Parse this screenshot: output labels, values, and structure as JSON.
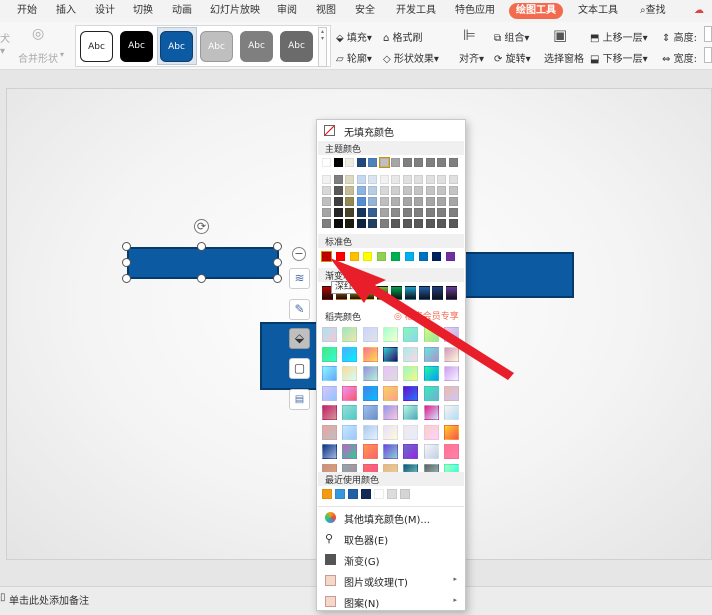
{
  "menu": {
    "tabs": [
      {
        "label": "开始"
      },
      {
        "label": "插入"
      },
      {
        "label": "设计"
      },
      {
        "label": "切换"
      },
      {
        "label": "动画"
      },
      {
        "label": "幻灯片放映"
      },
      {
        "label": "审阅"
      },
      {
        "label": "视图"
      },
      {
        "label": "安全"
      },
      {
        "label": "开发工具"
      },
      {
        "label": "特色应用"
      },
      {
        "label": "绘图工具"
      },
      {
        "label": "文本工具"
      }
    ],
    "search_label": "查找"
  },
  "ribbon": {
    "merge_shape": "合并形状",
    "style_sample": "Abc",
    "fill": "填充",
    "format_painter": "格式刷",
    "outline": "轮廓",
    "shape_effects": "形状效果",
    "align": "对齐",
    "group": "组合",
    "rotate": "旋转",
    "selection_pane": "选择窗格",
    "bring_forward": "上移一层",
    "send_backward": "下移一层",
    "height_label": "高度:",
    "width_label": "宽度:"
  },
  "dropdown": {
    "no_fill": "无填充颜色",
    "theme_colors": "主题颜色",
    "standard_colors": "标准色",
    "gradient_label": "渐变填充",
    "tooltip": "深红",
    "daoke_colors": "稻壳颜色",
    "member_badge": "稻壳会员专享",
    "recent_colors": "最近使用颜色",
    "items": [
      {
        "label": "其他填充颜色(M)...",
        "has_submenu": false
      },
      {
        "label": "取色器(E)",
        "has_submenu": false
      },
      {
        "label": "渐变(G)",
        "has_submenu": false
      },
      {
        "label": "图片或纹理(T)",
        "has_submenu": true
      },
      {
        "label": "图案(N)",
        "has_submenu": true
      }
    ],
    "theme_top_row": [
      "#ffffff",
      "#000000",
      "#eeece1",
      "#1f497d",
      "#4f81bd",
      "#c0c0c0",
      "#a6a6a6",
      "#808080",
      "#808080",
      "#808080",
      "#808080",
      "#808080"
    ],
    "theme_shades": [
      [
        "#f2f2f2",
        "#7f7f7f",
        "#ddd9c3",
        "#c6d9f0",
        "#dbe5f1",
        "#f2f2f2",
        "#e8e8e8",
        "#e0e0e0",
        "#e0e0e0",
        "#e0e0e0",
        "#e0e0e0",
        "#e0e0e0"
      ],
      [
        "#d8d8d8",
        "#595959",
        "#c4bd97",
        "#8db3e2",
        "#b8cce4",
        "#d8d8d8",
        "#cfcfcf",
        "#c4c4c4",
        "#c4c4c4",
        "#c4c4c4",
        "#c4c4c4",
        "#c4c4c4"
      ],
      [
        "#bfbfbf",
        "#3f3f3f",
        "#938953",
        "#548dd4",
        "#95b3d7",
        "#bfbfbf",
        "#b0b0b0",
        "#a6a6a6",
        "#a6a6a6",
        "#a6a6a6",
        "#a6a6a6",
        "#a6a6a6"
      ],
      [
        "#a5a5a5",
        "#262626",
        "#494429",
        "#17365d",
        "#366092",
        "#a5a5a5",
        "#8c8c8c",
        "#7f7f7f",
        "#7f7f7f",
        "#7f7f7f",
        "#7f7f7f",
        "#7f7f7f"
      ],
      [
        "#7f7f7f",
        "#0c0c0c",
        "#1d1b10",
        "#0f243e",
        "#244061",
        "#7f7f7f",
        "#595959",
        "#595959",
        "#595959",
        "#595959",
        "#595959",
        "#595959"
      ]
    ],
    "standard": [
      "#c00000",
      "#ff0000",
      "#ffc000",
      "#ffff00",
      "#92d050",
      "#00b050",
      "#00b0f0",
      "#0070c0",
      "#002060",
      "#7030a0"
    ],
    "gradient_row": [
      "#c00000",
      "#e36c09",
      "#f5b800",
      "#f0e000",
      "#7dbb3a",
      "#00a050",
      "#1b9fd0",
      "#1f60b0",
      "#1c3d80",
      "#6a3aa0"
    ],
    "recent": [
      "#f39c12",
      "#3498db",
      "#1f5fa8",
      "#132a55",
      "#ffffff",
      "#dddddd",
      "#d5d5d5"
    ],
    "gradients": [
      [
        "#a8e6f0,#f7c6d9",
        "#9be7c4,#f2e6a8",
        "#c9d6ff,#e2e2e2",
        "#a1ffce,#faffd1",
        "#84fab0,#8fd3f4",
        "#d4fc79,#96e6a1",
        "#fbc2eb,#a6c1ee"
      ],
      [
        "#43e97b,#38f9d7",
        "#4facfe,#00f2fe",
        "#fa709a,#fee140",
        "#30cfd0,#330867",
        "#a8edea,#fed6e3",
        "#5ee7df,#b490ca",
        "#d299c2,#fef9d7"
      ],
      [
        "#89f7fe,#66a6ff",
        "#fddb92,#d1fdff",
        "#9890e3,#b1f4cf",
        "#ebc0fd,#d9ded8",
        "#96fbc4,#f9f586",
        "#2af598,#009efd",
        "#cd9cf2,#f6f3ff"
      ],
      [
        "#e0c3fc,#8ec5fc",
        "#f093fb,#f5576c",
        "#4481eb,#04befe",
        "#f6d365,#fda085",
        "#6a11cb,#2575fc",
        "#37ecba,#72afd3",
        "#ebbba7,#cfc7f8"
      ],
      [
        "#c71d6f,#d09693",
        "#96deda,#50c9c3",
        "#a3bded,#6991c7",
        "#9795f0,#fbc8d4",
        "#b7f8db,#50a7c2",
        "#e8198b,#c7eafd",
        "#fff1eb,#ace0f9"
      ],
      [
        "#eea2a2,#bbc1bf",
        "#c2e9fb,#a1c4fd",
        "#accbee,#e7f0fd",
        "#e9defa,#fbfcdb",
        "#f3e7e9,#e3eeff",
        "#fad0c4,#ffd1ff",
        "#f9d423,#ff4e50"
      ],
      [
        "#0c3483,#a2b6df",
        "#d558c8,#24d292",
        "#ff9a44,#fc6076",
        "#6e45e2,#88d3ce",
        "#5f72bd,#9b23ea",
        "#f5f7fa,#c3cfe2",
        "#ff758c,#ff7eb3"
      ],
      [
        "#c79081,#dfa579",
        "#8baaaa,#ae8b9c",
        "#f77062,#fe5196",
        "#e6b980,#eacda3",
        "#13547a,#80d0c7",
        "#616161,#9bc5c3",
        "#b3ffab,#12fff7"
      ]
    ]
  },
  "status": {
    "notes_prompt": "单击此处添加备注"
  },
  "accent": "#f26b4e",
  "shape_color": "#0b5aa2",
  "arrow_color": "#e81f2a"
}
